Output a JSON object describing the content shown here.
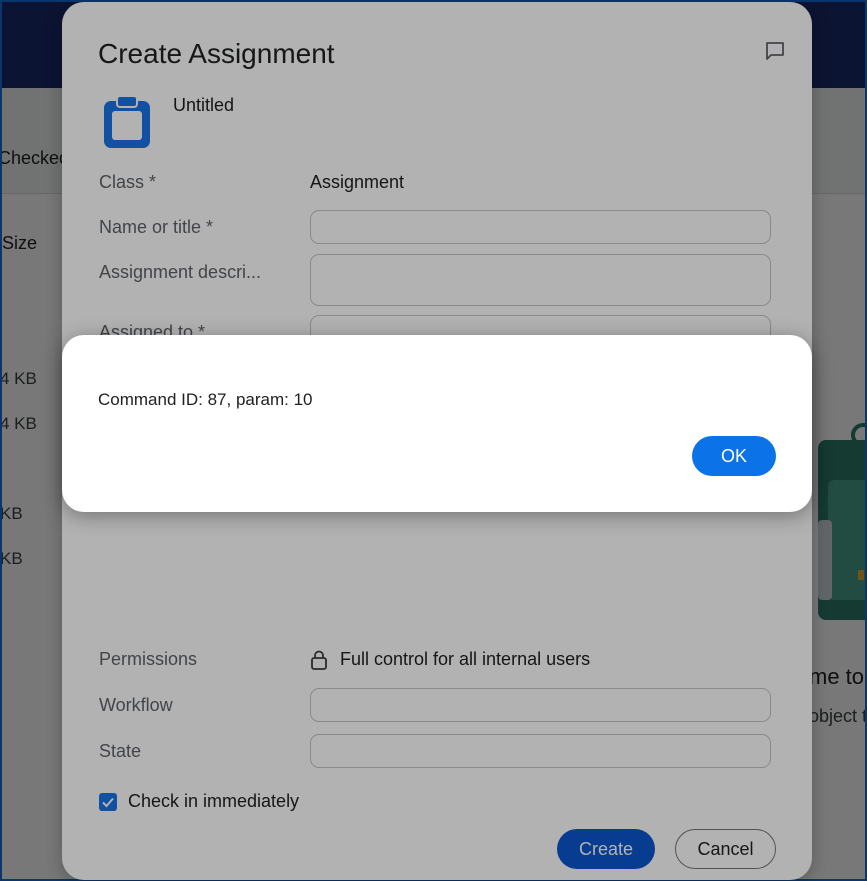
{
  "background": {
    "checked_tab": "Checked",
    "size_header": "Size",
    "file_sizes": [
      "4 KB",
      "4 KB",
      "KB",
      "KB"
    ],
    "welcome_text": "me to",
    "object_text": "object t"
  },
  "create_dialog": {
    "title": "Create Assignment",
    "doc_name": "Untitled",
    "class_label": "Class *",
    "class_value": "Assignment",
    "name_label": "Name or title *",
    "name_value": "",
    "description_label": "Assignment descri...",
    "description_value": "",
    "assigned_label": "Assigned to *",
    "permissions_label": "Permissions",
    "permissions_value": "Full control for all internal users",
    "workflow_label": "Workflow",
    "workflow_value": "",
    "state_label": "State",
    "state_value": "",
    "check_in_label": "Check in immediately",
    "check_in_checked": true,
    "create_label": "Create",
    "cancel_label": "Cancel"
  },
  "alert": {
    "message": "Command ID: 87, param: 10",
    "ok_label": "OK"
  },
  "colors": {
    "topbar": "#1a2c6b",
    "primary": "#0b57d0",
    "ok_button": "#0b72e7",
    "doc_icon": "#1a73e8"
  },
  "icons": {
    "feedback": "feedback-icon",
    "document": "clipboard-document-icon",
    "lock": "lock-icon",
    "checkbox": "checkbox-checked-icon"
  }
}
